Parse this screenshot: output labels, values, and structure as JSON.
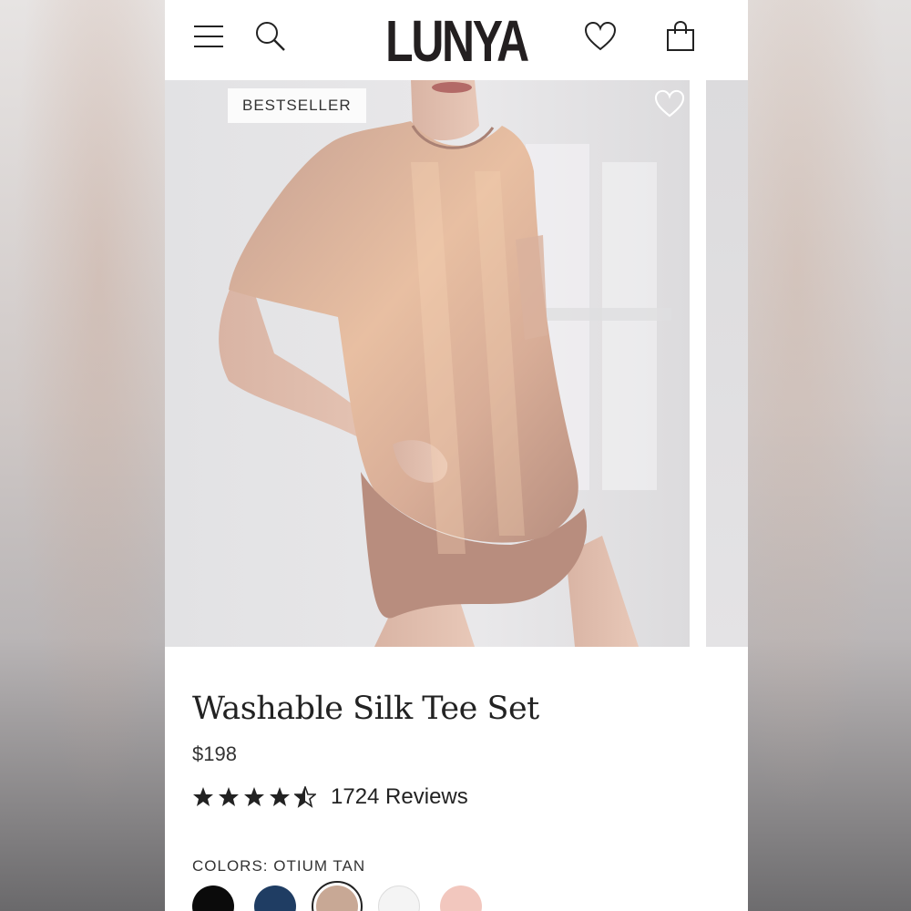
{
  "header": {
    "logo": "LUNYA",
    "icons": [
      "menu-icon",
      "search-icon",
      "heart-icon",
      "bag-icon"
    ]
  },
  "carousel": {
    "badge": "BESTSELLER",
    "favorite_icon": "heart-outline-icon"
  },
  "product": {
    "title": "Washable Silk Tee Set",
    "price": "$198",
    "rating": 4.5,
    "reviews": "1724 Reviews",
    "colors_label": "COLORS: OTIUM TAN",
    "swatches": [
      {
        "name": "black",
        "color": "#0b0b0b"
      },
      {
        "name": "navy",
        "color": "#1f3d63"
      },
      {
        "name": "otium tan",
        "color": "#c8a895",
        "selected": true
      },
      {
        "name": "white",
        "color": "#f4f4f4"
      },
      {
        "name": "blush",
        "color": "#f2c7be"
      }
    ]
  }
}
